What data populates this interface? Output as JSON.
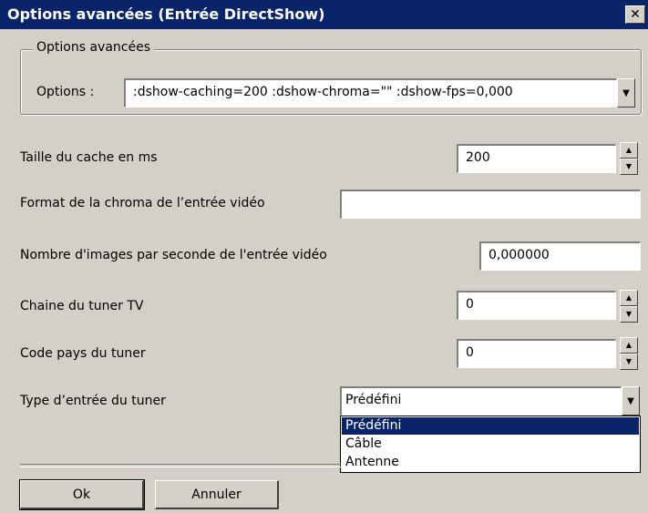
{
  "window": {
    "title": "Options avancées (Entrée DirectShow)",
    "close_glyph": "✕"
  },
  "advanced_group": {
    "legend": "Options avancées",
    "options_label": "Options :",
    "options_value": ":dshow-caching=200 :dshow-chroma=\"\" :dshow-fps=0,000"
  },
  "fields": {
    "cache_label": "Taille du cache en ms",
    "cache_value": "200",
    "chroma_label": "Format de la chroma de l’entrée vidéo",
    "chroma_value": "",
    "fps_label": "Nombre d'images par seconde de l'entrée vidéo",
    "fps_value": "0,000000",
    "tuner_channel_label": "Chaine du tuner TV",
    "tuner_channel_value": "0",
    "tuner_country_label": "Code pays du tuner",
    "tuner_country_value": "0",
    "tuner_input_label": "Type d’entrée du tuner",
    "tuner_input_value": "Prédéfini"
  },
  "dropdown": {
    "options": [
      "Prédéfini",
      "Câble",
      "Antenne"
    ],
    "selected": "Prédéfini"
  },
  "buttons": {
    "ok_label": "Ok",
    "cancel_label": "Annuler"
  },
  "icons": {
    "combo_arrow": "▼",
    "spin_up": "▲",
    "spin_down": "▼"
  }
}
